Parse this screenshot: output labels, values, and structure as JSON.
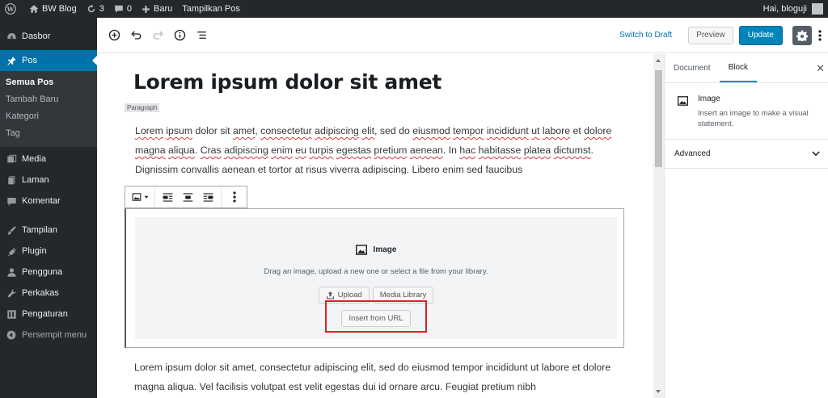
{
  "adminbar": {
    "site_name": "BW Blog",
    "updates_count": "3",
    "comments_count": "0",
    "new_label": "Baru",
    "view_post_label": "Tampilkan Pos",
    "greeting": "Hai, bloguji"
  },
  "sidebar": {
    "dashboard": "Dasbor",
    "posts": "Pos",
    "posts_sub": [
      "Semua Pos",
      "Tambah Baru",
      "Kategori",
      "Tag"
    ],
    "media": "Media",
    "pages": "Laman",
    "comments": "Komentar",
    "appearance": "Tampilan",
    "plugins": "Plugin",
    "users": "Pengguna",
    "tools": "Perkakas",
    "settings": "Pengaturan",
    "collapse": "Persempit menu"
  },
  "header": {
    "switch_to_draft": "Switch to Draft",
    "preview": "Preview",
    "update": "Update"
  },
  "editor": {
    "title": "Lorem ipsum dolor sit amet",
    "block_label": "Paragraph",
    "selected_paragraph": [
      {
        "t": " ",
        "s": false
      },
      {
        "t": "Lorem",
        "s": true
      },
      {
        "t": " ",
        "s": false
      },
      {
        "t": "ipsum",
        "s": true
      },
      {
        "t": " dolor sit ",
        "s": false
      },
      {
        "t": "amet",
        "s": true
      },
      {
        "t": ", ",
        "s": false
      },
      {
        "t": "consectetur",
        "s": true
      },
      {
        "t": " ",
        "s": false
      },
      {
        "t": "adipiscing",
        "s": true
      },
      {
        "t": " ",
        "s": false
      },
      {
        "t": "elit",
        "s": true
      },
      {
        "t": ", sed do ",
        "s": false
      },
      {
        "t": "eiusmod",
        "s": true
      },
      {
        "t": " ",
        "s": false
      },
      {
        "t": "tempor",
        "s": true
      },
      {
        "t": " ",
        "s": false
      },
      {
        "t": "incididunt",
        "s": true
      },
      {
        "t": " ",
        "s": false
      },
      {
        "t": "ut",
        "s": true
      },
      {
        "t": " ",
        "s": false
      },
      {
        "t": "labore",
        "s": true
      },
      {
        "t": " et ",
        "s": false
      },
      {
        "t": "dolore",
        "s": true
      },
      {
        "t": " ",
        "s": false
      },
      {
        "t": "magna",
        "s": true
      },
      {
        "t": " ",
        "s": false
      },
      {
        "t": "aliqua",
        "s": true
      },
      {
        "t": ". ",
        "s": false
      },
      {
        "t": "Cras",
        "s": true
      },
      {
        "t": " ",
        "s": false
      },
      {
        "t": "adipiscing",
        "s": true
      },
      {
        "t": " ",
        "s": false
      },
      {
        "t": "enim",
        "s": true
      },
      {
        "t": " ",
        "s": false
      },
      {
        "t": "eu",
        "s": true
      },
      {
        "t": " ",
        "s": false
      },
      {
        "t": "turpis",
        "s": true
      },
      {
        "t": " ",
        "s": false
      },
      {
        "t": "egestas",
        "s": true
      },
      {
        "t": " ",
        "s": false
      },
      {
        "t": "pretium",
        "s": true
      },
      {
        "t": " ",
        "s": false
      },
      {
        "t": "aenean",
        "s": true
      },
      {
        "t": ". In ",
        "s": false
      },
      {
        "t": "hac",
        "s": true
      },
      {
        "t": " ",
        "s": false
      },
      {
        "t": "habitasse",
        "s": true
      },
      {
        "t": " ",
        "s": false
      },
      {
        "t": "platea",
        "s": true
      },
      {
        "t": " ",
        "s": false
      },
      {
        "t": "dictumst",
        "s": true
      },
      {
        "t": ". ",
        "s": false
      },
      {
        "t": "Dignissim",
        "s": true
      },
      {
        "t": " ",
        "s": false
      },
      {
        "t": "convallis",
        "s": true
      },
      {
        "t": " ",
        "s": false
      },
      {
        "t": "aenean",
        "s": true
      },
      {
        "t": " et ",
        "s": false
      },
      {
        "t": "tortor",
        "s": true
      },
      {
        "t": " at ",
        "s": false
      },
      {
        "t": "risus",
        "s": true
      },
      {
        "t": " ",
        "s": false
      },
      {
        "t": "viverra",
        "s": true
      },
      {
        "t": " ",
        "s": false
      },
      {
        "t": "adipiscing",
        "s": true
      },
      {
        "t": ". ",
        "s": false
      },
      {
        "t": "Libero",
        "s": true
      },
      {
        "t": " ",
        "s": false
      },
      {
        "t": "enim",
        "s": true
      },
      {
        "t": " sed ",
        "s": false
      },
      {
        "t": "faucibus",
        "s": true
      }
    ],
    "image_block": {
      "title": "Image",
      "instructions": "Drag an image, upload a new one or select a file from your library.",
      "upload": "Upload",
      "media_library": "Media Library",
      "insert_from_url": "Insert from URL"
    },
    "next_paragraph": "Lorem ipsum dolor sit amet, consectetur adipiscing elit, sed do eiusmod tempor incididunt ut labore et dolore magna aliqua. Vel facilisis volutpat est velit egestas dui id ornare arcu. Feugiat pretium nibh"
  },
  "settings_panel": {
    "tab_document": "Document",
    "tab_block": "Block",
    "block_title": "Image",
    "block_description": "Insert an image to make a visual statement.",
    "advanced": "Advanced"
  },
  "colors": {
    "adminbar_bg": "#23282d",
    "accent": "#0073aa",
    "update_btn": "#0085ba",
    "highlight": "#e02020"
  }
}
